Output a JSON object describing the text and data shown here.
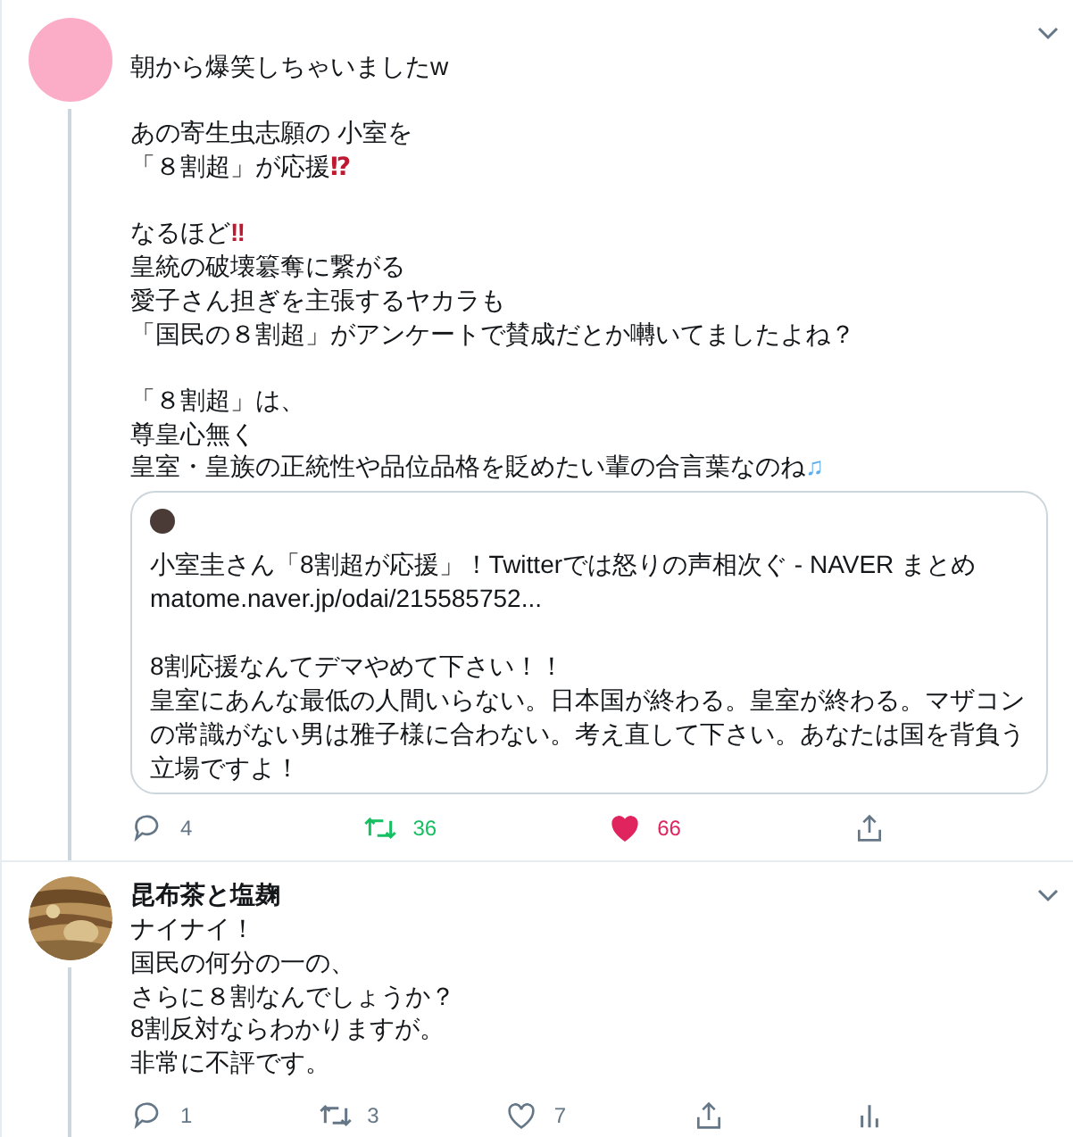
{
  "tweets": [
    {
      "avatar": {
        "color": "#fbadc8"
      },
      "paragraphs": [
        [
          {
            "text": "朝から爆笑しちゃいましたw"
          }
        ],
        [
          {
            "text": "あの寄生虫志願の 小室を"
          },
          {
            "text": "「８割超」が応援",
            "emoji": {
              "text": "⁉",
              "color": "#be1931"
            }
          }
        ],
        [
          {
            "text": "なるほど",
            "emoji": {
              "text": "‼",
              "color": "#be1931"
            }
          },
          {
            "text": "皇統の破壊簒奪に繋がる"
          },
          {
            "text": "愛子さん担ぎを主張するヤカラも"
          },
          {
            "text": "「国民の８割超」がアンケートで賛成だとか囀いてましたよね？"
          }
        ],
        [
          {
            "text": "「８割超」は、"
          },
          {
            "text": "尊皇心無く"
          },
          {
            "text": "皇室・皇族の正統性や品位品格を貶めたい輩の合言葉なのね",
            "emoji": {
              "text": "♫",
              "color": "#5dadec"
            }
          }
        ]
      ],
      "card": {
        "title": "小室圭さん「8割超が応援」！Twitterでは怒りの声相次ぐ - NAVER まとめ",
        "url": "matome.naver.jp/odai/215585752...",
        "quote": [
          "8割応援なんてデマやめて下さい！！",
          "皇室にあんな最低の人間いらない。日本国が終わる。皇室が終わる。マザコンの常識がない男は雅子様に合わない。考え直して下さい。あなたは国を背負う立場ですよ！"
        ]
      },
      "actions": [
        {
          "kind": "reply",
          "count": "4",
          "active": false
        },
        {
          "kind": "retweet",
          "count": "36",
          "active": true
        },
        {
          "kind": "like",
          "count": "66",
          "active": true
        },
        {
          "kind": "share"
        }
      ]
    },
    {
      "avatar": {
        "kind": "picture"
      },
      "name": "昆布茶と塩麹",
      "paragraphs": [
        [
          {
            "text": "ナイナイ！"
          },
          {
            "text": "国民の何分の一の、"
          },
          {
            "text": "さらに８割なんでしょうか？"
          },
          {
            "text": "8割反対ならわかりますが。"
          },
          {
            "text": "非常に不評です。"
          }
        ]
      ],
      "actions": [
        {
          "kind": "reply",
          "count": "1",
          "active": false
        },
        {
          "kind": "retweet",
          "count": "3",
          "active": false
        },
        {
          "kind": "like",
          "count": "7",
          "active": false
        },
        {
          "kind": "share"
        },
        {
          "kind": "analytics"
        }
      ]
    }
  ]
}
